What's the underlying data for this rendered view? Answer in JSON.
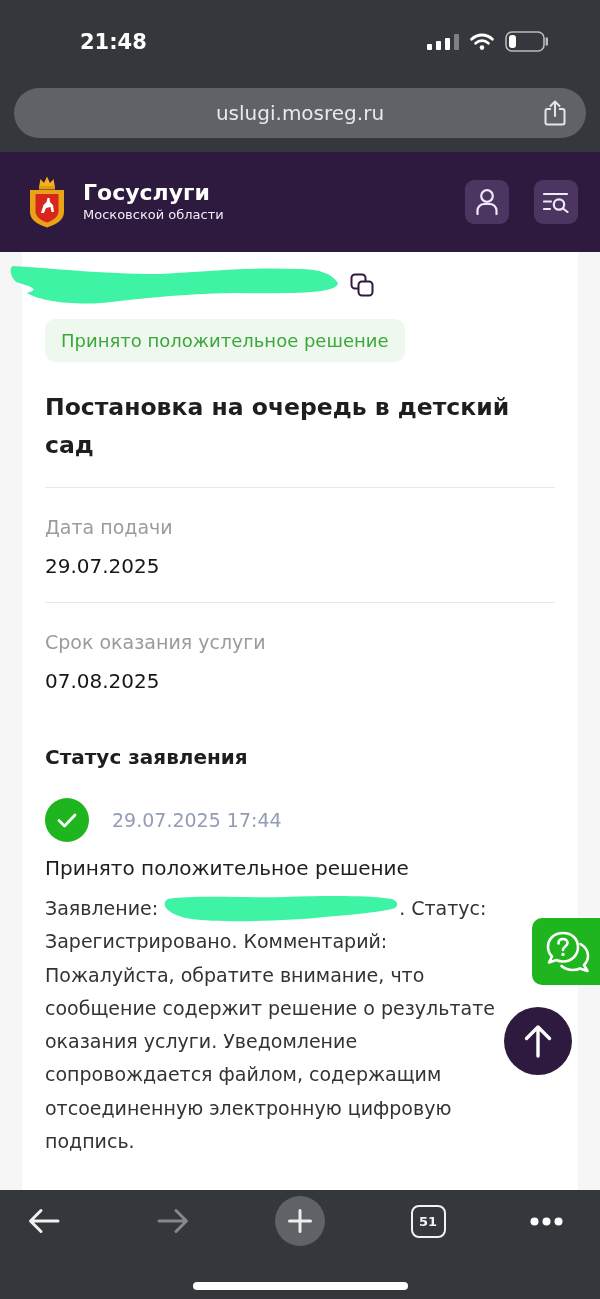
{
  "status_bar": {
    "time": "21:48"
  },
  "browser": {
    "url": "uslugi.mosreg.ru"
  },
  "site_header": {
    "title": "Госуслуги",
    "subtitle": "Московской области"
  },
  "application": {
    "number_redacted": true,
    "status_badge": "Принято положительное решение",
    "title": "Постановка на очередь в детский сад",
    "fields": [
      {
        "label": "Дата подачи",
        "value": "29.07.2025"
      },
      {
        "label": "Срок оказания услуги",
        "value": "07.08.2025"
      }
    ]
  },
  "status_history": {
    "heading": "Статус заявления",
    "entries": [
      {
        "done": true,
        "datetime": "29.07.2025 17:44",
        "title": "Принято положительное решение",
        "message_lead": "Заявление:",
        "message_redacted": true,
        "message_rest": ". Статус: Зарегистрировано. Комментарий: Пожалуйста, обратите внимание, что сообщение содержит решение о результате оказания услуги. Уведомление сопровождается файлом, содержащим отсоединенную электронную цифровую подпись."
      }
    ]
  },
  "toolbar": {
    "back_disabled": false,
    "forward_disabled": true,
    "tab_count": "51"
  }
}
